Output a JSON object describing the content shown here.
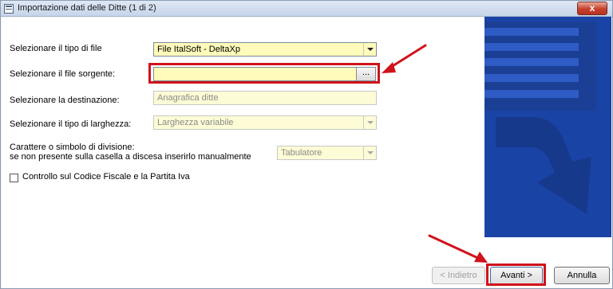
{
  "window": {
    "title": "Importazione dati delle Ditte (1 di 2)",
    "close_glyph": "x"
  },
  "form": {
    "file_type": {
      "label": "Selezionare il tipo di file",
      "value": "File ItalSoft - DeltaXp"
    },
    "source_file": {
      "label": "Selezionare il file sorgente:",
      "value": "",
      "browse_label": "..."
    },
    "destination": {
      "label": "Selezionare la destinazione:",
      "value": "Anagrafica ditte"
    },
    "width_type": {
      "label": "Selezionare il tipo di larghezza:",
      "value": "Larghezza variabile"
    },
    "separator": {
      "label_line1": "Carattere o simbolo di divisione:",
      "label_line2": "se non presente sulla casella a discesa inserirlo manualmente",
      "value": "Tabulatore"
    },
    "check_tax_code": {
      "label": "Controllo sul Codice Fiscale e la Partita Iva",
      "checked": false
    }
  },
  "buttons": {
    "back_label": "< Indietro",
    "next_label": "Avanti >",
    "cancel_label": "Annulla"
  },
  "colors": {
    "highlight": "#d0121b",
    "art_blue": "#1a43a6",
    "field_yellow": "#fdfbc8"
  }
}
